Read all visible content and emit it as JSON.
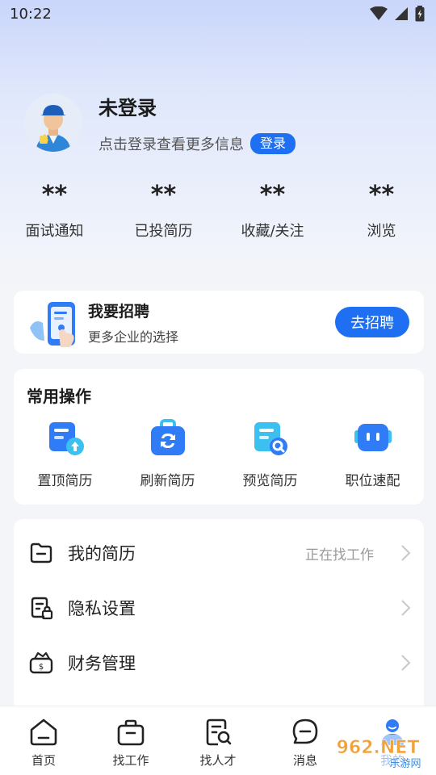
{
  "status": {
    "time": "10:22"
  },
  "profile": {
    "name": "未登录",
    "hint": "点击登录查看更多信息",
    "login_label": "登录"
  },
  "stats": [
    {
      "value": "**",
      "label": "面试通知"
    },
    {
      "value": "**",
      "label": "已投简历"
    },
    {
      "value": "**",
      "label": "收藏/关注"
    },
    {
      "value": "**",
      "label": "浏览"
    }
  ],
  "recruit": {
    "title": "我要招聘",
    "subtitle": "更多企业的选择",
    "button": "去招聘"
  },
  "ops": {
    "title": "常用操作",
    "items": [
      {
        "label": "置顶简历",
        "icon": "resume-top-icon"
      },
      {
        "label": "刷新简历",
        "icon": "refresh-resume-icon"
      },
      {
        "label": "预览简历",
        "icon": "preview-resume-icon"
      },
      {
        "label": "职位速配",
        "icon": "job-match-icon"
      }
    ]
  },
  "menu": {
    "items": [
      {
        "label": "我的简历",
        "value": "正在找工作",
        "icon": "folder-icon"
      },
      {
        "label": "隐私设置",
        "value": "",
        "icon": "privacy-lock-icon"
      },
      {
        "label": "财务管理",
        "value": "",
        "icon": "wallet-icon"
      }
    ]
  },
  "tabs": [
    {
      "label": "首页",
      "icon": "home-icon"
    },
    {
      "label": "找工作",
      "icon": "briefcase-icon"
    },
    {
      "label": "找人才",
      "icon": "talent-search-icon"
    },
    {
      "label": "消息",
      "icon": "message-icon"
    },
    {
      "label": "我的",
      "icon": "profile-icon"
    }
  ],
  "watermark": {
    "brand": "962.NET",
    "sub": "乐游网"
  },
  "colors": {
    "accent": "#1f6ff2",
    "icon_blue": "#2f7cf6",
    "icon_teal": "#3cc0f0"
  }
}
